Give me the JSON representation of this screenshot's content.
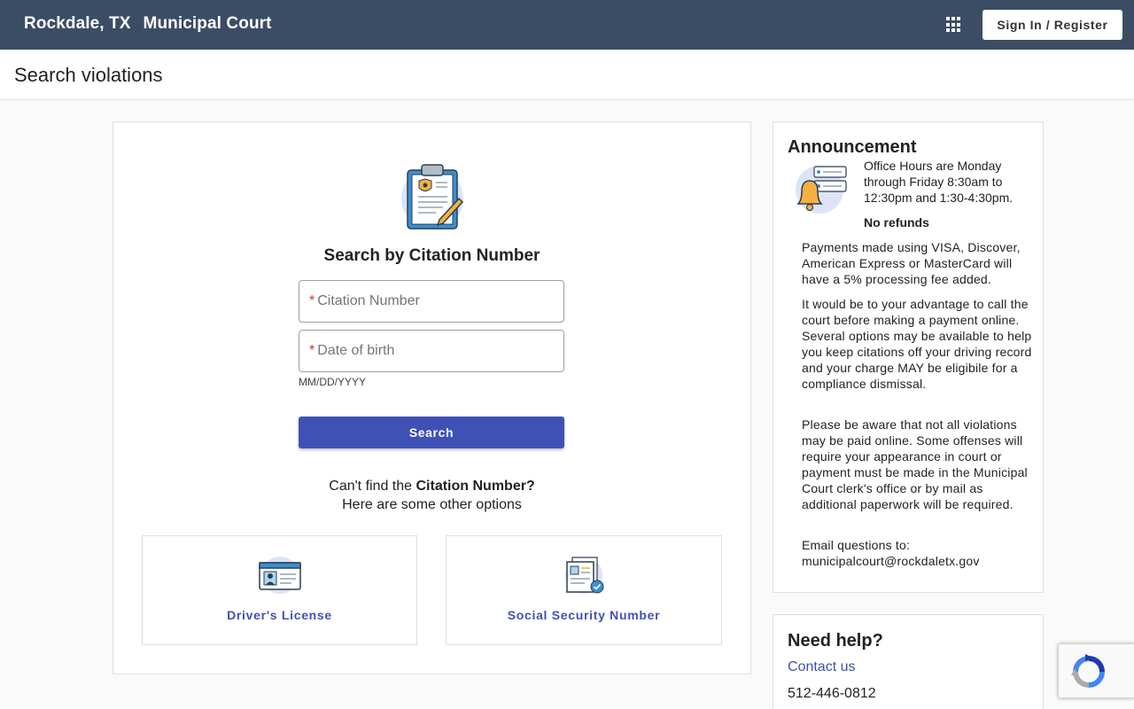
{
  "header": {
    "city": "Rockdale, TX",
    "court": "Municipal Court",
    "signin_label": "Sign In / Register"
  },
  "page": {
    "title": "Search violations"
  },
  "search": {
    "title": "Search by Citation Number",
    "citation_placeholder": "Citation Number",
    "dob_placeholder": "Date of birth",
    "dob_hint": "MM/DD/YYYY",
    "required_mark": "*",
    "button_label": "Search",
    "cant_find_prefix": "Can't find the",
    "cant_find_bold": "Citation Number?",
    "other_options": "Here are some other options"
  },
  "options": [
    {
      "label": "Driver's License"
    },
    {
      "label": "Social Security Number"
    }
  ],
  "announcement": {
    "title": "Announcement",
    "hours": "Office Hours are Monday through Friday 8:30am to 12:30pm and 1:30-4:30pm.",
    "no_refunds": "No refunds",
    "p1": "Payments made using VISA, Discover, American Express or MasterCard will have a 5% processing fee added.",
    "p2": "It would be to your advantage to call the court before making a payment online. Several options may be available to help you keep citations off your driving record and your charge MAY be eligibile for a compliance dismissal.",
    "p3": "Please be aware that not all violations may be paid online. Some offenses will require your appearance in court or payment must be made in the Municipal Court clerk's office or by mail as additional paperwork will be required.",
    "p4": "Email questions to: municipalcourt@rockdaletx.gov"
  },
  "help": {
    "title": "Need help?",
    "contact_label": "Contact us",
    "phone": "512-446-0812"
  },
  "colors": {
    "header_bg": "#3b4d64",
    "accent": "#3f51b5",
    "required": "#c0392b"
  }
}
